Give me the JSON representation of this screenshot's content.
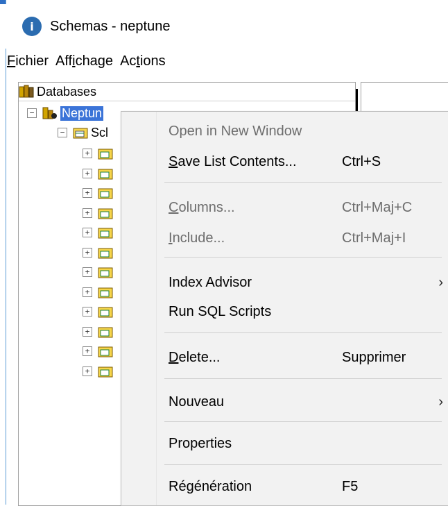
{
  "window": {
    "title": "Schemas - neptune",
    "icon": "info-circle-icon"
  },
  "menubar": [
    {
      "label": "Fichier",
      "underline": "F"
    },
    {
      "label": "Affichage",
      "underline": "i"
    },
    {
      "label": "Actions",
      "underline": "i"
    }
  ],
  "tree": {
    "root_label": "Databases",
    "server_label": "Neptun",
    "schema_label": "Scl",
    "child_count": 12
  },
  "context_menu": {
    "items": [
      {
        "label": "Open in New Window",
        "shortcut": "",
        "disabled": true,
        "submenu": false
      },
      {
        "label": "Save List Contents...",
        "shortcut": "Ctrl+S",
        "disabled": false,
        "submenu": false
      },
      {
        "label": "Columns...",
        "shortcut": "Ctrl+Maj+C",
        "disabled": true,
        "submenu": false
      },
      {
        "label": "Include...",
        "shortcut": "Ctrl+Maj+I",
        "disabled": true,
        "submenu": false
      },
      {
        "label": "Index Advisor",
        "shortcut": "",
        "disabled": false,
        "submenu": true
      },
      {
        "label": "Run SQL Scripts",
        "shortcut": "",
        "disabled": false,
        "submenu": false
      },
      {
        "label": "Delete...",
        "shortcut": "Supprimer",
        "disabled": false,
        "submenu": false
      },
      {
        "label": "Nouveau",
        "shortcut": "",
        "disabled": false,
        "submenu": true
      },
      {
        "label": "Properties",
        "shortcut": "",
        "disabled": false,
        "submenu": false
      },
      {
        "label": "Régénération",
        "shortcut": "F5",
        "disabled": false,
        "submenu": false
      }
    ]
  },
  "colors": {
    "selection": "#3b74d8",
    "menu_bg": "#f2f2f2",
    "disabled_text": "#6d6d6d"
  }
}
